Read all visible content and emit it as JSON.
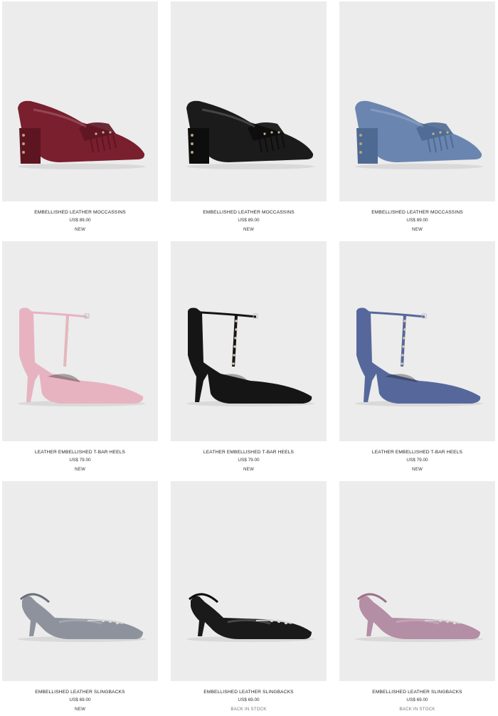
{
  "products": [
    {
      "name": "EMBELLISHED LEATHER MOCCASSINS",
      "price": "US$ 89.00",
      "badge": "NEW",
      "icon": "moccasin-shoe-icon",
      "color": "#7a1f2e",
      "accent": "#5e1522"
    },
    {
      "name": "EMBELLISHED LEATHER MOCCASSINS",
      "price": "US$ 89.00",
      "badge": "NEW",
      "icon": "moccasin-shoe-icon",
      "color": "#1b1b1b",
      "accent": "#0d0d0d"
    },
    {
      "name": "EMBELLISHED LEATHER MOCCASSINS",
      "price": "US$ 89.00",
      "badge": "NEW",
      "icon": "moccasin-shoe-icon",
      "color": "#6a86b0",
      "accent": "#4f6a92"
    },
    {
      "name": "LEATHER EMBELLISHED T-BAR HEELS",
      "price": "US$ 79.00",
      "badge": "NEW",
      "icon": "t-bar-heel-icon",
      "color": "#e7b3c1",
      "accent": "#cc93a5"
    },
    {
      "name": "LEATHER EMBELLISHED T-BAR HEELS",
      "price": "US$ 79.00",
      "badge": "NEW",
      "icon": "t-bar-heel-icon",
      "color": "#151515",
      "accent": "#050505"
    },
    {
      "name": "LEATHER EMBELLISHED T-BAR HEELS",
      "price": "US$ 79.00",
      "badge": "NEW",
      "icon": "t-bar-heel-icon",
      "color": "#56689b",
      "accent": "#3f4f7e"
    },
    {
      "name": "EMBELLISHED LEATHER SLINGBACKS",
      "price": "US$ 69.00",
      "badge": "NEW",
      "icon": "slingback-shoe-icon",
      "color": "#8d929c",
      "accent": "#6b7079"
    },
    {
      "name": "EMBELLISHED LEATHER SLINGBACKS",
      "price": "US$ 69.00",
      "badge": "BACK IN STOCK",
      "icon": "slingback-shoe-icon",
      "color": "#1a1a1a",
      "accent": "#0a0a0a"
    },
    {
      "name": "EMBELLISHED LEATHER SLINGBACKS",
      "price": "US$ 69.00",
      "badge": "BACK IN STOCK",
      "icon": "slingback-shoe-icon",
      "color": "#b48ea4",
      "accent": "#9a7389"
    }
  ]
}
